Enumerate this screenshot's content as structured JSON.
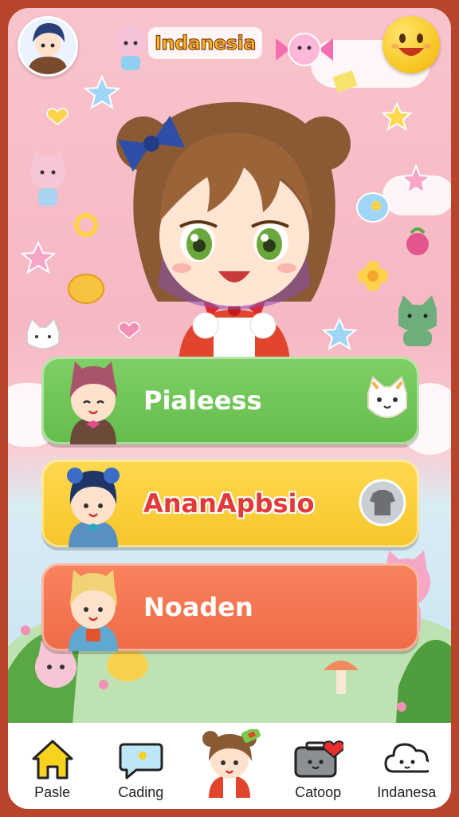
{
  "header": {
    "title": "Indanesia",
    "profile_icon": "profile-avatar-icon",
    "mood_icon": "smiley-icon"
  },
  "menu": [
    {
      "label": "Pialeess",
      "color": "#6cc353",
      "right_icon": "cat-face-icon"
    },
    {
      "label": "AnanApbsio",
      "color": "#f8cd3a",
      "right_icon": "shirt-icon"
    },
    {
      "label": "Noaden",
      "color": "#f2744f",
      "right_icon": "pink-cats-icon"
    }
  ],
  "nav": [
    {
      "label": "Pasle",
      "icon": "home-icon"
    },
    {
      "label": "Cading",
      "icon": "chat-bubble-icon"
    },
    {
      "label": "",
      "icon": "character-icon"
    },
    {
      "label": "Catoop",
      "icon": "suitcase-heart-icon"
    },
    {
      "label": "Indanesa",
      "icon": "cloud-face-icon"
    }
  ],
  "colors": {
    "frame": "#b8442c",
    "background_pink": "#f8c4cc",
    "title_fill": "#f5b820",
    "title_outline": "#8a3a12"
  }
}
